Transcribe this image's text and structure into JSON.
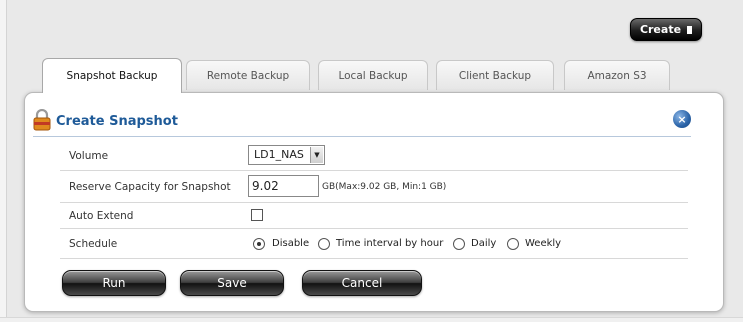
{
  "toolbar": {
    "create_label": "Create"
  },
  "tabs": [
    {
      "label": "Snapshot Backup",
      "active": true
    },
    {
      "label": "Remote Backup",
      "active": false
    },
    {
      "label": "Local Backup",
      "active": false
    },
    {
      "label": "Client Backup",
      "active": false
    },
    {
      "label": "Amazon S3",
      "active": false
    }
  ],
  "panel": {
    "title": "Create Snapshot"
  },
  "form": {
    "volume": {
      "label": "Volume",
      "value": "LD1_NAS"
    },
    "reserve": {
      "label": "Reserve Capacity for Snapshot",
      "value": "9.02",
      "hint": "GB(Max:9.02 GB, Min:1 GB)"
    },
    "auto_extend": {
      "label": "Auto Extend",
      "checked": false
    },
    "schedule": {
      "label": "Schedule",
      "options": [
        {
          "label": "Disable",
          "selected": true
        },
        {
          "label": "Time interval by hour",
          "selected": false
        },
        {
          "label": "Daily",
          "selected": false
        },
        {
          "label": "Weekly",
          "selected": false
        }
      ]
    }
  },
  "buttons": {
    "run": "Run",
    "save": "Save",
    "cancel": "Cancel"
  },
  "colors": {
    "title": "#1e5a98",
    "close_icon": "#2a63a8"
  }
}
